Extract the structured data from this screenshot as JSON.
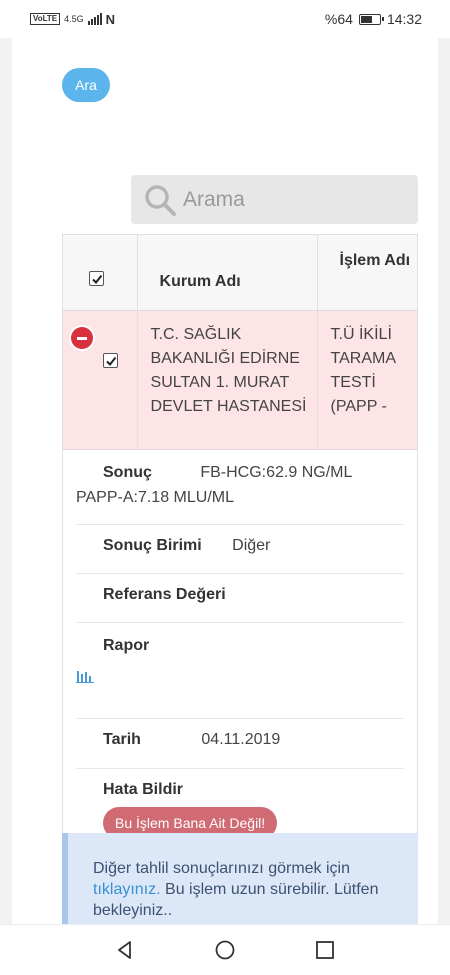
{
  "status_bar": {
    "network_badge": "VoLTE",
    "network_type": "4.5G",
    "battery_percent": "%64",
    "battery_level": 0.64,
    "time": "14:32"
  },
  "ara_button": "Ara",
  "search": {
    "placeholder": "Arama"
  },
  "table": {
    "header": {
      "institution": "Kurum Adı",
      "procedure": "İşlem Adı"
    },
    "row": {
      "institution": "T.C. SAĞLIK BAKANLIĞI EDİRNE SULTAN 1. MURAT DEVLET HASTANESİ",
      "procedure": "T.Ü İKİLİ TARAMA TESTİ (PAPP -"
    }
  },
  "details": {
    "sonuc_label": "Sonuç",
    "sonuc_value_line1": "FB-HCG:62.9 NG/ML",
    "sonuc_value_line2": "PAPP-A:7.18 MLU/ML",
    "sonuc_birimi_label": "Sonuç Birimi",
    "sonuc_birimi_value": "Diğer",
    "referans_label": "Referans Değeri",
    "rapor_label": "Rapor",
    "tarih_label": "Tarih",
    "tarih_value": "04.11.2019",
    "hata_label": "Hata Bildir",
    "hata_button": "Bu İşlem Bana Ait Değil!"
  },
  "info": {
    "text_before": "Diğer tahlil sonuçlarınızı görmek için ",
    "link": "tıklayınız.",
    "text_after": " Bu işlem uzun sürebilir. Lütfen bekleyiniz.."
  },
  "colors": {
    "accent": "#5bb5ec",
    "row_highlight": "#fde4e6",
    "danger": "#d9303d",
    "info_bg": "#dce8f7",
    "link": "#3a8fd1"
  }
}
